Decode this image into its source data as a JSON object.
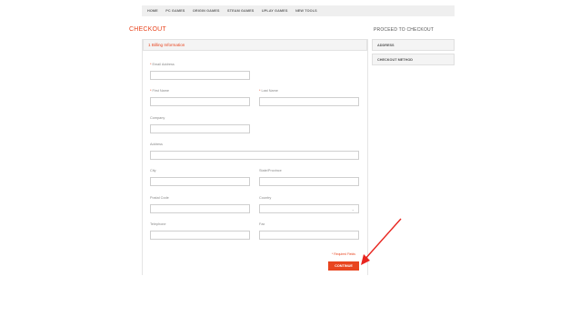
{
  "nav": {
    "items": [
      "HOME",
      "PC GAMES",
      "ORIGIN GAMES",
      "STEAM GAMES",
      "UPLAY GAMES",
      "NEW TOOLS"
    ]
  },
  "page": {
    "title": "CHECKOUT"
  },
  "billing": {
    "header": "1 Billing Information",
    "required_mark": "*",
    "fields": {
      "email": "Email Address",
      "first_name": "First Name",
      "last_name": "Last Name",
      "company": "Company",
      "address": "Address",
      "city": "City",
      "state": "State/Province",
      "postal": "Postal Code",
      "country": "Country",
      "telephone": "Telephone",
      "fax": "Fax"
    },
    "required_note": "* Required Fields",
    "continue_label": "CONTINUE"
  },
  "sidebar": {
    "title": "PROCEED TO CHECKOUT",
    "items": [
      "ADDRESS",
      "CHECKOUT METHOD"
    ]
  },
  "colors": {
    "accent": "#e8451f",
    "arrow": "#e8251f"
  },
  "icons": {
    "country_dropdown": "chevron-down-icon"
  }
}
